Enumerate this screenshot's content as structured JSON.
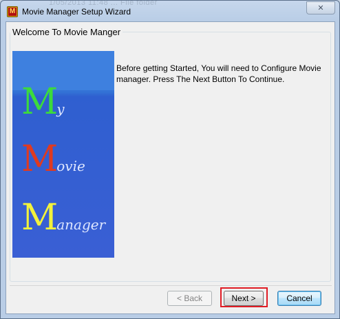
{
  "window": {
    "title": "Movie Manager Setup Wizard",
    "app_icon_letter": "M",
    "close_glyph": "✕",
    "background_ghost_text": "1/05/2013 11:48 ... File folder"
  },
  "page": {
    "group_title": "Welcome To Movie Manger",
    "description": "Before getting Started, You will need to Configure Movie manager. Press The Next Button To Continue."
  },
  "banner": {
    "rows": [
      {
        "big": "M",
        "small": "y",
        "color": "#3cdb3c"
      },
      {
        "big": "M",
        "small": "ovie",
        "color": "#e03a20"
      },
      {
        "big": "M",
        "small": "anager",
        "color": "#f2f23c"
      }
    ]
  },
  "buttons": {
    "back": "< Back",
    "next": "Next >",
    "cancel": "Cancel"
  },
  "colors": {
    "highlight": "#e01b24",
    "banner_blue": "#3a5fd4"
  }
}
